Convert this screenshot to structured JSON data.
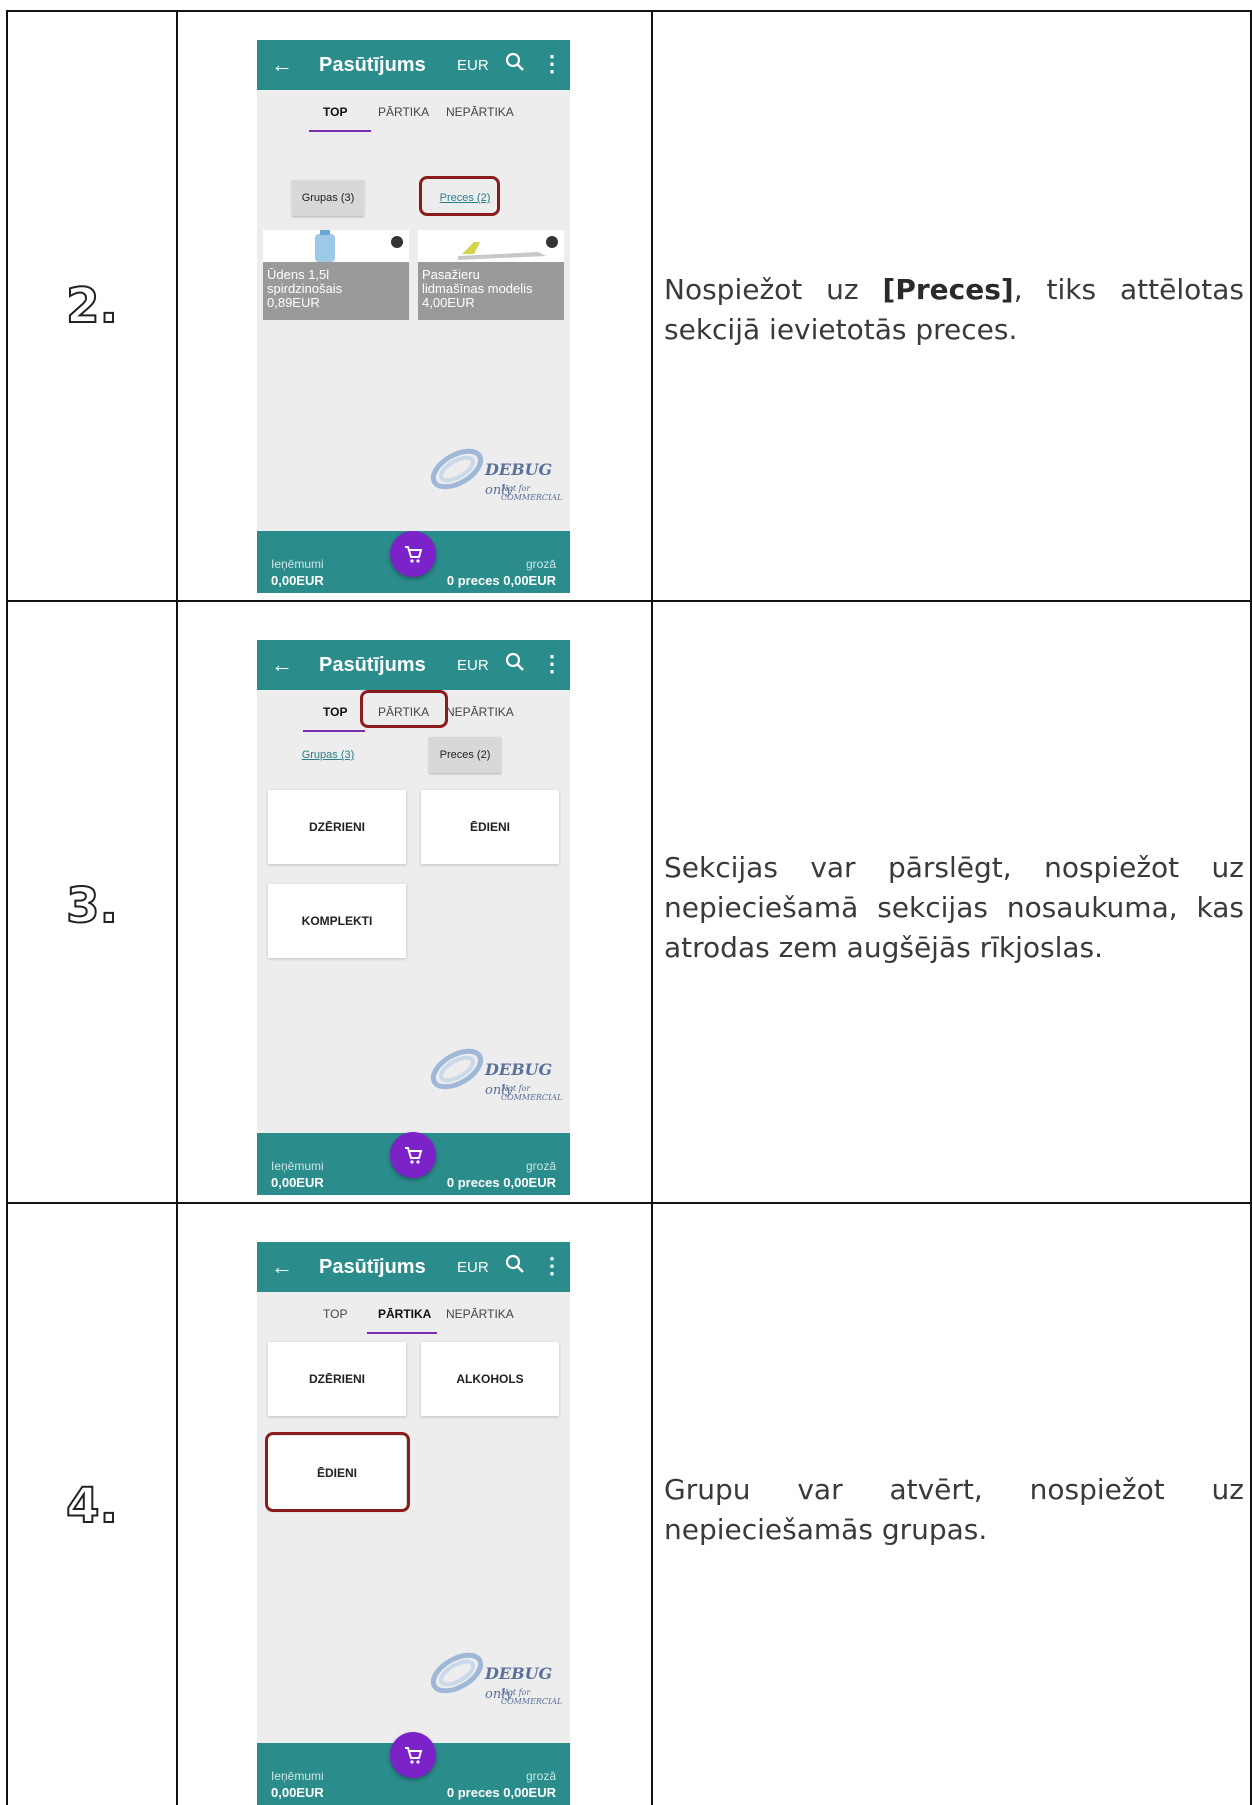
{
  "rows": [
    {
      "number": "2.",
      "description_parts": [
        "Nospiežot uz ",
        "[Preces]",
        ", tiks attēlotas sekcijā ievietotās preces."
      ],
      "phone": {
        "title": "Pasūtījums",
        "currency": "EUR",
        "tabs": [
          "TOP",
          "PĀRTIKA",
          "NEPĀRTIKA"
        ],
        "buttons": [
          "Grupas (3)",
          "Preces (2)"
        ],
        "products": [
          {
            "name": "Ūdens 1,5l",
            "name2": "spirdzinošais",
            "price": "0,89EUR"
          },
          {
            "name": "Pasažieru",
            "name2": "lidmašīnas modelis",
            "price": "4,00EUR"
          }
        ]
      }
    },
    {
      "number": "3.",
      "description": "Sekcijas var pārslēgt, nospiežot uz nepieciešamā sekcijas nosaukuma, kas atrodas zem augšējās rīkjoslas.",
      "phone": {
        "title": "Pasūtījums",
        "currency": "EUR",
        "tabs": [
          "TOP",
          "PĀRTIKA",
          "NEPĀRTIKA"
        ],
        "buttons": [
          "Grupas (3)",
          "Preces (2)"
        ],
        "tiles": [
          "DZĒRIENI",
          "ĒDIENI",
          "KOMPLEKTI"
        ]
      }
    },
    {
      "number": "4.",
      "description": "Grupu var atvērt, nospiežot uz nepieciešamās grupas.",
      "phone": {
        "title": "Pasūtījums",
        "currency": "EUR",
        "tabs": [
          "TOP",
          "PĀRTIKA",
          "NEPĀRTIKA"
        ],
        "tiles": [
          "DZĒRIENI",
          "ALKOHOLS",
          "ĒDIENI"
        ]
      }
    }
  ],
  "bottom_bar": {
    "left_label": "Ieņēmumi",
    "left_value": "0,00EUR",
    "right_label": "grozā",
    "right_value": "0 preces 0,00EUR"
  },
  "watermark": {
    "main": "DEBUG",
    "suffix": " only",
    "sub": "Not for COMMERCIAL"
  }
}
